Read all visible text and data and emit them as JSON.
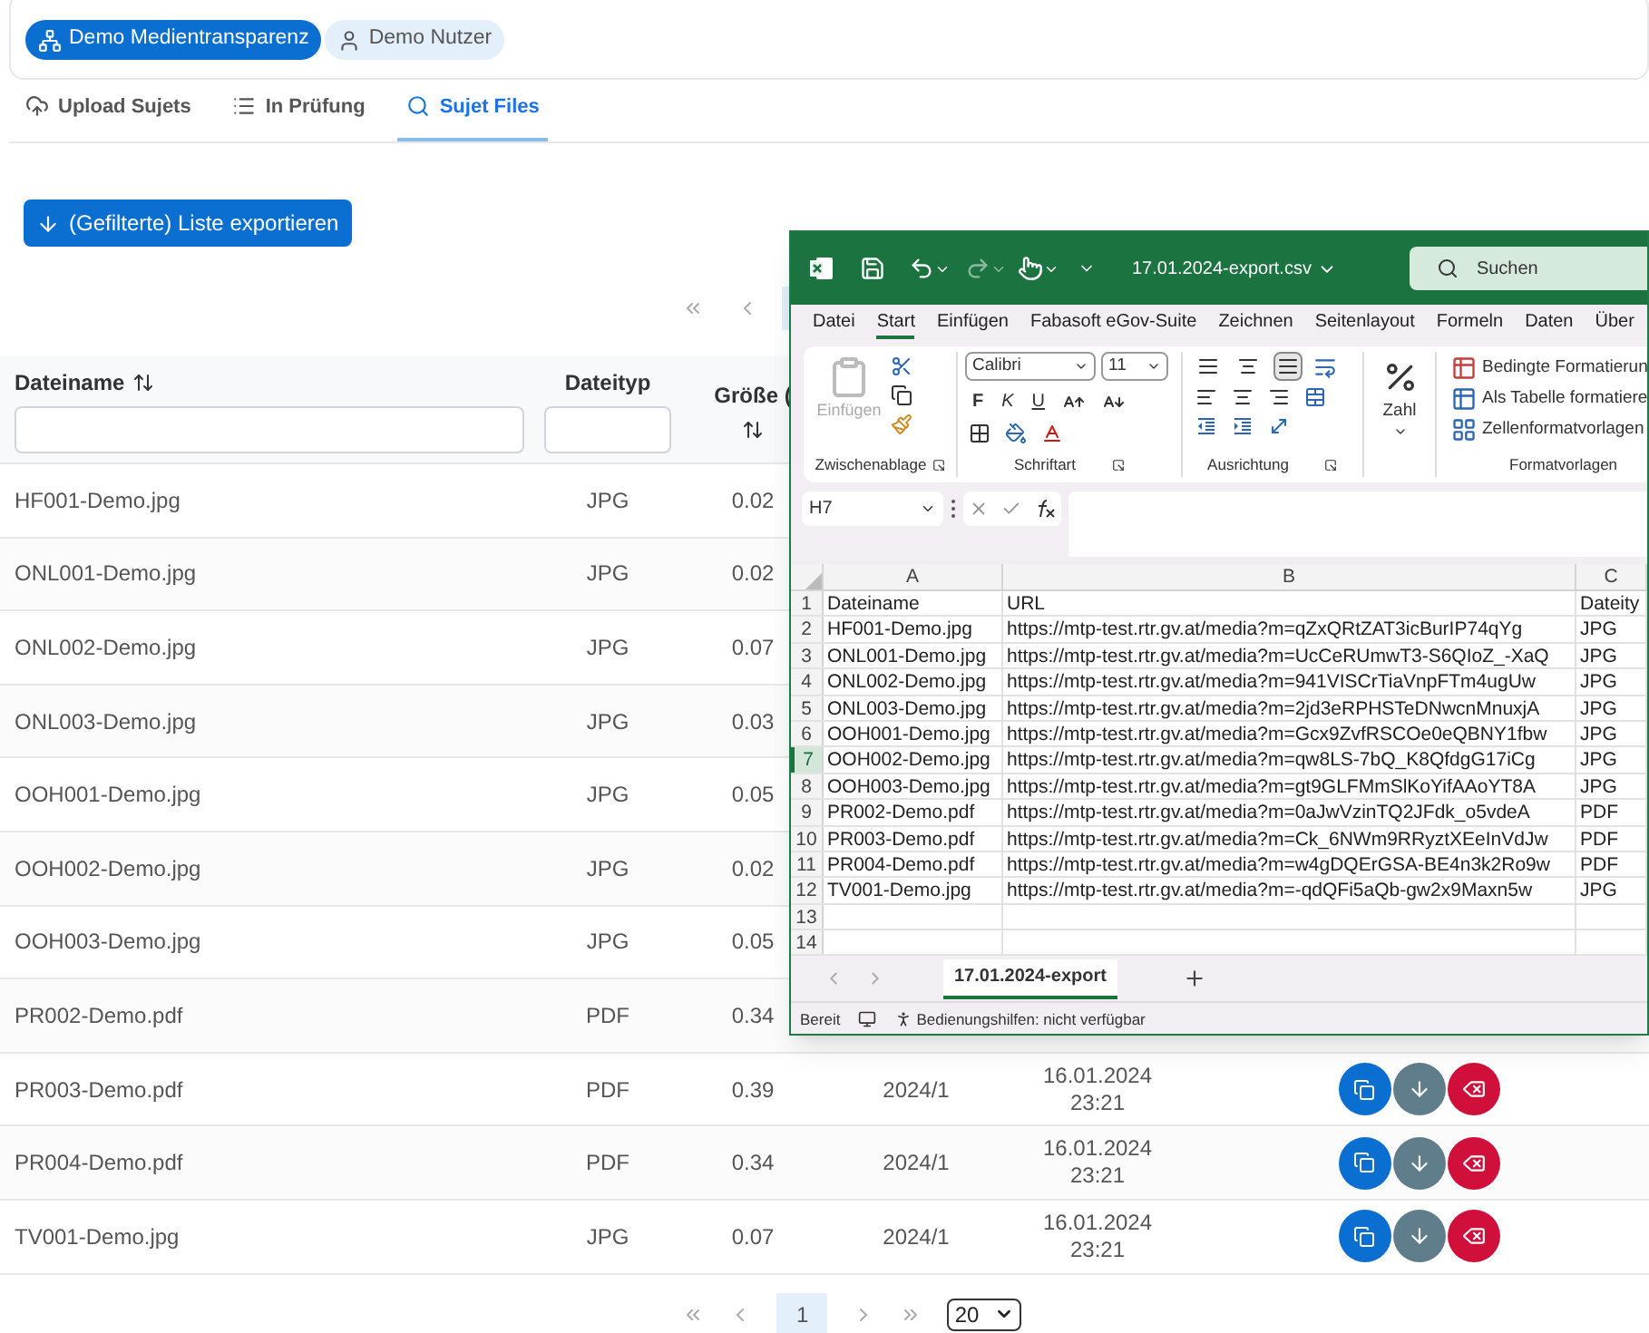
{
  "header": {
    "chips": [
      {
        "label": "Demo Medientransparenz",
        "kind": "org",
        "selected": true
      },
      {
        "label": "Demo Nutzer",
        "kind": "user",
        "selected": false
      }
    ]
  },
  "tabs": [
    {
      "label": "Upload Sujets",
      "kind": "upload",
      "selected": false
    },
    {
      "label": "In Prüfung",
      "kind": "list",
      "selected": false
    },
    {
      "label": "Sujet Files",
      "kind": "search",
      "selected": true
    }
  ],
  "export_button": {
    "label": "(Gefilterte) Liste exportieren"
  },
  "table": {
    "columns": [
      {
        "label": "Dateiname",
        "sortable": true,
        "filter": true
      },
      {
        "label": "Dateityp",
        "sortable": false,
        "filter": true
      },
      {
        "label": "Größe (",
        "sortable": true,
        "filter": false
      }
    ],
    "rows": [
      {
        "name": "HF001-Demo.jpg",
        "type": "JPG",
        "size": "0.02"
      },
      {
        "name": "ONL001-Demo.jpg",
        "type": "JPG",
        "size": "0.02"
      },
      {
        "name": "ONL002-Demo.jpg",
        "type": "JPG",
        "size": "0.07"
      },
      {
        "name": "ONL003-Demo.jpg",
        "type": "JPG",
        "size": "0.03"
      },
      {
        "name": "OOH001-Demo.jpg",
        "type": "JPG",
        "size": "0.05"
      },
      {
        "name": "OOH002-Demo.jpg",
        "type": "JPG",
        "size": "0.02"
      },
      {
        "name": "OOH003-Demo.jpg",
        "type": "JPG",
        "size": "0.05"
      },
      {
        "name": "PR002-Demo.pdf",
        "type": "PDF",
        "size": "0.34"
      },
      {
        "name": "PR003-Demo.pdf",
        "type": "PDF",
        "size": "0.39",
        "period": "2024/1",
        "date": "16.01.2024",
        "time": "23:21"
      },
      {
        "name": "PR004-Demo.pdf",
        "type": "PDF",
        "size": "0.34",
        "period": "2024/1",
        "date": "16.01.2024",
        "time": "23:21"
      },
      {
        "name": "TV001-Demo.jpg",
        "type": "JPG",
        "size": "0.07",
        "period": "2024/1",
        "date": "16.01.2024",
        "time": "23:21"
      }
    ]
  },
  "pagination": {
    "page": "1",
    "page_size": "20"
  },
  "excel": {
    "title": "17.01.2024-export.csv",
    "search": {
      "placeholder": "Suchen"
    },
    "menu": [
      {
        "label": "Datei",
        "selected": false
      },
      {
        "label": "Start",
        "selected": true
      },
      {
        "label": "Einfügen",
        "selected": false
      },
      {
        "label": "Fabasoft eGov-Suite",
        "selected": false
      },
      {
        "label": "Zeichnen",
        "selected": false
      },
      {
        "label": "Seitenlayout",
        "selected": false
      },
      {
        "label": "Formeln",
        "selected": false
      },
      {
        "label": "Daten",
        "selected": false
      },
      {
        "label": "Über",
        "selected": false
      }
    ],
    "ribbon": {
      "paste": {
        "label": "Einfügen",
        "disabled": true
      },
      "font": "Calibri",
      "font_size": "11",
      "bold": "F",
      "italic": "K",
      "underline": "U",
      "vertical_align": [
        {
          "selected": false
        },
        {
          "selected": false
        },
        {
          "selected": true
        }
      ],
      "number": "Zahl",
      "styles": [
        {
          "label": "Bedingte Formatierun",
          "kind": "conditional"
        },
        {
          "label": "Als Tabelle formatiere",
          "kind": "table"
        },
        {
          "label": "Zellenformatvorlagen",
          "kind": "cell"
        }
      ],
      "groups": [
        "Zwischenablage",
        "Schriftart",
        "Ausrichtung",
        "Formatvorlagen"
      ]
    },
    "name_box": "H7",
    "columns": [
      "A",
      "B",
      "C"
    ],
    "rows": [
      {
        "number": "1",
        "selected": false,
        "cells": [
          "Dateiname",
          "URL",
          "Dateity"
        ]
      },
      {
        "number": "2",
        "selected": false,
        "cells": [
          "HF001-Demo.jpg",
          "https://mtp-test.rtr.gv.at/media?m=qZxQRtZAT3icBurIP74qYg",
          "JPG"
        ]
      },
      {
        "number": "3",
        "selected": false,
        "cells": [
          "ONL001-Demo.jpg",
          "https://mtp-test.rtr.gv.at/media?m=UcCeRUmwT3-S6QIoZ_-XaQ",
          "JPG"
        ]
      },
      {
        "number": "4",
        "selected": false,
        "cells": [
          "ONL002-Demo.jpg",
          "https://mtp-test.rtr.gv.at/media?m=941VISCrTiaVnpFTm4ugUw",
          "JPG"
        ]
      },
      {
        "number": "5",
        "selected": false,
        "cells": [
          "ONL003-Demo.jpg",
          "https://mtp-test.rtr.gv.at/media?m=2jd3eRPHSTeDNwcnMnuxjA",
          "JPG"
        ]
      },
      {
        "number": "6",
        "selected": false,
        "cells": [
          "OOH001-Demo.jpg",
          "https://mtp-test.rtr.gv.at/media?m=Gcx9ZvfRSCOe0eQBNY1fbw",
          "JPG"
        ]
      },
      {
        "number": "7",
        "selected": true,
        "cells": [
          "OOH002-Demo.jpg",
          "https://mtp-test.rtr.gv.at/media?m=qw8LS-7bQ_K8QfdgG17iCg",
          "JPG"
        ]
      },
      {
        "number": "8",
        "selected": false,
        "cells": [
          "OOH003-Demo.jpg",
          "https://mtp-test.rtr.gv.at/media?m=gt9GLFMmSlKoYifAAoYT8A",
          "JPG"
        ]
      },
      {
        "number": "9",
        "selected": false,
        "cells": [
          "PR002-Demo.pdf",
          "https://mtp-test.rtr.gv.at/media?m=0aJwVzinTQ2JFdk_o5vdeA",
          "PDF"
        ]
      },
      {
        "number": "10",
        "selected": false,
        "cells": [
          "PR003-Demo.pdf",
          "https://mtp-test.rtr.gv.at/media?m=Ck_6NWm9RRyztXEeInVdJw",
          "PDF"
        ]
      },
      {
        "number": "11",
        "selected": false,
        "cells": [
          "PR004-Demo.pdf",
          "https://mtp-test.rtr.gv.at/media?m=w4gDQErGSA-BE4n3k2Ro9w",
          "PDF"
        ]
      },
      {
        "number": "12",
        "selected": false,
        "cells": [
          "TV001-Demo.jpg",
          "https://mtp-test.rtr.gv.at/media?m=-qdQFi5aQb-gw2x9Maxn5w",
          "JPG"
        ]
      },
      {
        "number": "13",
        "selected": false
      },
      {
        "number": "14",
        "selected": false
      }
    ],
    "sheets": [
      {
        "label": "17.01.2024-export",
        "selected": true
      }
    ],
    "status": "Bereit",
    "accessibility": "Bedienungshilfen: nicht verfügbar"
  }
}
